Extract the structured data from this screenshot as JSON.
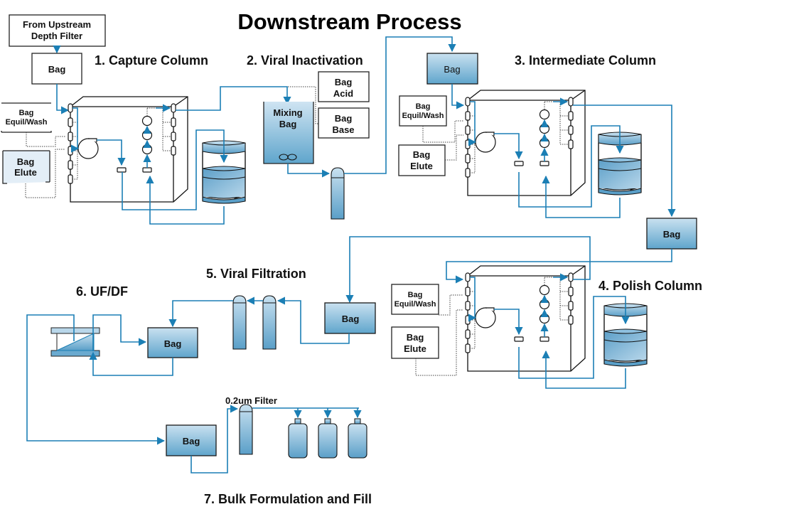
{
  "title": "Downstream Process",
  "colors": {
    "flow_line": "#1b7fb5",
    "bag_fill_top": "#c9e1f0",
    "bag_fill_bottom": "#5fa5cc",
    "elute_fill": "#e3eef7"
  },
  "steps": {
    "s1": "1. Capture Column",
    "s2": "2. Viral Inactivation",
    "s3": "3. Intermediate Column",
    "s4": "4. Polish Column",
    "s5": "5. Viral Filtration",
    "s6": "6. UF/DF",
    "s7": "7. Bulk Formulation and Fill"
  },
  "nodes": {
    "upstream_line1": "From Upstream",
    "upstream_line2": "Depth Filter",
    "bag": "Bag",
    "equil_line1": "Bag",
    "equil_line2": "Equil/Wash",
    "elute_line1": "Bag",
    "elute_line2": "Elute",
    "acid_line1": "Bag",
    "acid_line2": "Acid",
    "base_line1": "Bag",
    "base_line2": "Base",
    "mixing_line1": "Mixing",
    "mixing_line2": "Bag",
    "filter_label": "0.2um Filter"
  }
}
